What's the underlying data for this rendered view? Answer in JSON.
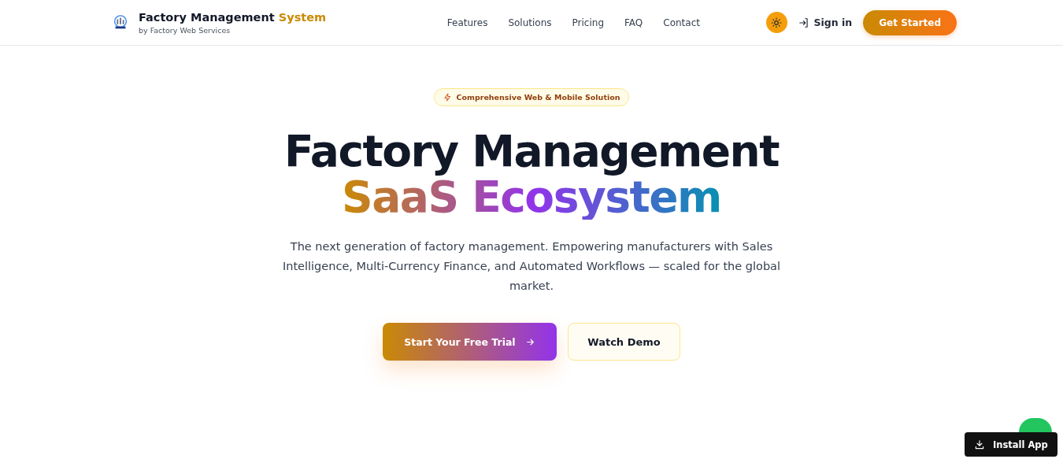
{
  "brand": {
    "title": "Factory Management",
    "title_accent": "System",
    "subtitle": "by Factory Web Services"
  },
  "nav": [
    {
      "label": "Features"
    },
    {
      "label": "Solutions"
    },
    {
      "label": "Pricing"
    },
    {
      "label": "FAQ"
    },
    {
      "label": "Contact"
    }
  ],
  "header_actions": {
    "sign_in": "Sign in",
    "get_started": "Get Started"
  },
  "hero": {
    "badge": "Comprehensive Web & Mobile Solution",
    "headline": "Factory Management",
    "headline_accent": "SaaS Ecosystem",
    "description": "The next generation of factory management. Empowering manufacturers with Sales Intelligence, Multi-Currency Finance, and Automated Workflows — scaled for the global market.",
    "primary_button": "Start Your Free Trial",
    "secondary_button": "Watch Demo"
  },
  "install_button": "Install App"
}
